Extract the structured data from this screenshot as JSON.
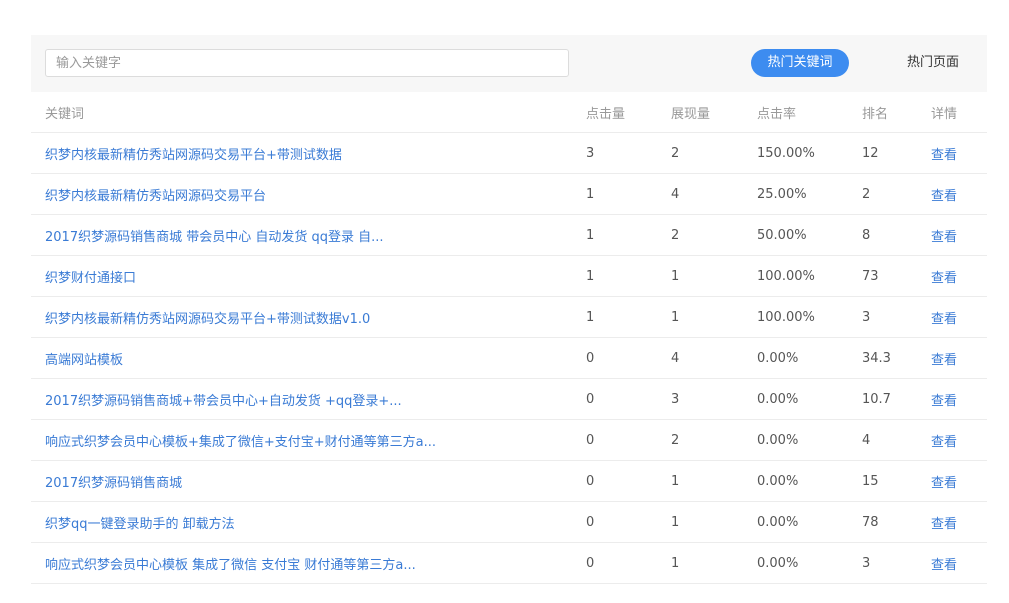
{
  "search": {
    "placeholder": "输入关键字"
  },
  "tabs": {
    "hot_keywords": "热门关键词",
    "hot_pages": "热门页面"
  },
  "table": {
    "headers": {
      "keyword": "关键词",
      "clicks": "点击量",
      "impressions": "展现量",
      "ctr": "点击率",
      "rank": "排名",
      "detail": "详情"
    },
    "rows": [
      {
        "keyword": "织梦内核最新精仿秀站网源码交易平台+带测试数据",
        "clicks": "3",
        "impressions": "2",
        "ctr": "150.00%",
        "rank": "12",
        "detail": "查看"
      },
      {
        "keyword": "织梦内核最新精仿秀站网源码交易平台",
        "clicks": "1",
        "impressions": "4",
        "ctr": "25.00%",
        "rank": "2",
        "detail": "查看"
      },
      {
        "keyword": "2017织梦源码销售商城 带会员中心 自动发货 qq登录 自...",
        "clicks": "1",
        "impressions": "2",
        "ctr": "50.00%",
        "rank": "8",
        "detail": "查看"
      },
      {
        "keyword": "织梦财付通接口",
        "clicks": "1",
        "impressions": "1",
        "ctr": "100.00%",
        "rank": "73",
        "detail": "查看"
      },
      {
        "keyword": "织梦内核最新精仿秀站网源码交易平台+带测试数据v1.0",
        "clicks": "1",
        "impressions": "1",
        "ctr": "100.00%",
        "rank": "3",
        "detail": "查看"
      },
      {
        "keyword": "高端网站模板",
        "clicks": "0",
        "impressions": "4",
        "ctr": "0.00%",
        "rank": "34.3",
        "detail": "查看"
      },
      {
        "keyword": "2017织梦源码销售商城+带会员中心+自动发货 +qq登录+...",
        "clicks": "0",
        "impressions": "3",
        "ctr": "0.00%",
        "rank": "10.7",
        "detail": "查看"
      },
      {
        "keyword": "响应式织梦会员中心模板+集成了微信+支付宝+财付通等第三方a...",
        "clicks": "0",
        "impressions": "2",
        "ctr": "0.00%",
        "rank": "4",
        "detail": "查看"
      },
      {
        "keyword": "2017织梦源码销售商城",
        "clicks": "0",
        "impressions": "1",
        "ctr": "0.00%",
        "rank": "15",
        "detail": "查看"
      },
      {
        "keyword": "织梦qq一键登录助手的 卸载方法",
        "clicks": "0",
        "impressions": "1",
        "ctr": "0.00%",
        "rank": "78",
        "detail": "查看"
      },
      {
        "keyword": "响应式织梦会员中心模板 集成了微信 支付宝 财付通等第三方a...",
        "clicks": "0",
        "impressions": "1",
        "ctr": "0.00%",
        "rank": "3",
        "detail": "查看"
      }
    ]
  },
  "colors": {
    "accent": "#3d8cf0",
    "link": "#3a7bd5",
    "toolbar_bg": "#f7f7f7"
  }
}
